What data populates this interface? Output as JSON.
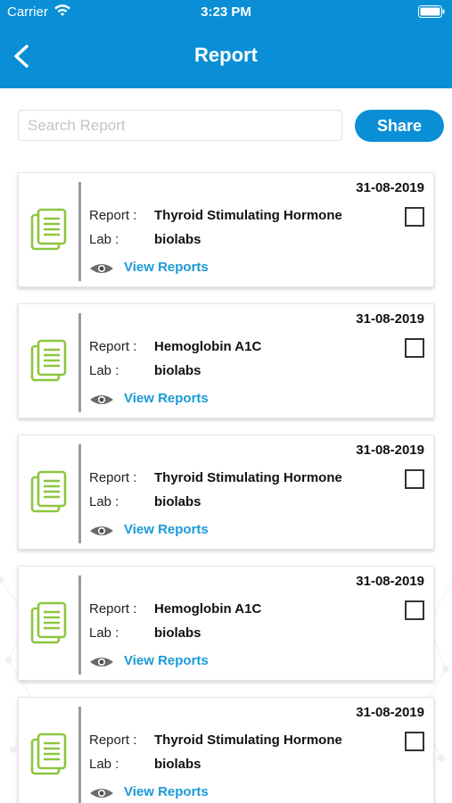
{
  "status_bar": {
    "carrier": "Carrier",
    "time": "3:23 PM"
  },
  "navbar": {
    "title": "Report",
    "back_icon": "chevron-left-icon"
  },
  "search": {
    "placeholder": "Search Report",
    "value": ""
  },
  "share_button": {
    "label": "Share"
  },
  "colors": {
    "primary": "#0a8fd6",
    "link": "#1a9ad8",
    "icon_green": "#8cc63f",
    "divider": "#9a9a9a"
  },
  "reports": [
    {
      "date": "31-08-2019",
      "report_label": "Report :",
      "report_name": "Thyroid Stimulating Hormone",
      "lab_label": "Lab :",
      "lab_name": "biolabs",
      "view_label": "View Reports",
      "checked": false
    },
    {
      "date": "31-08-2019",
      "report_label": "Report :",
      "report_name": "Hemoglobin A1C",
      "lab_label": "Lab :",
      "lab_name": "biolabs",
      "view_label": "View Reports",
      "checked": false
    },
    {
      "date": "31-08-2019",
      "report_label": "Report :",
      "report_name": "Thyroid Stimulating Hormone",
      "lab_label": "Lab :",
      "lab_name": "biolabs",
      "view_label": "View Reports",
      "checked": false
    },
    {
      "date": "31-08-2019",
      "report_label": "Report :",
      "report_name": "Hemoglobin A1C",
      "lab_label": "Lab :",
      "lab_name": "biolabs",
      "view_label": "View Reports",
      "checked": false
    },
    {
      "date": "31-08-2019",
      "report_label": "Report :",
      "report_name": "Thyroid Stimulating Hormone",
      "lab_label": "Lab :",
      "lab_name": "biolabs",
      "view_label": "View Reports",
      "checked": false
    }
  ]
}
